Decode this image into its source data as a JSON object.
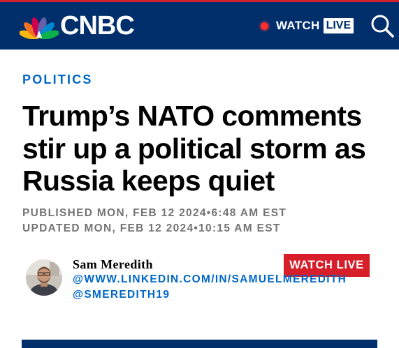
{
  "header": {
    "logo_text": "CNBC",
    "watch_label": "WATCH",
    "live_label": "LIVE",
    "colors": {
      "background": "#002f6c",
      "live_dot": "#ff2d2d",
      "accent_red": "#d61f2a"
    },
    "icons": {
      "logo": "nbc-peacock-icon",
      "search": "search-icon",
      "live": "live-dot-icon"
    }
  },
  "article": {
    "section": "POLITICS",
    "headline": "Trump’s NATO comments stir up a political storm as Russia keeps quiet",
    "published": "PUBLISHED MON, FEB 12 2024•6:48 AM EST",
    "updated": "UPDATED MON, FEB 12 2024•10:15 AM EST"
  },
  "author": {
    "name": "Sam Meredith",
    "linkedin": "@WWW.LINKEDIN.COM/IN/SAMUELMEREDITH",
    "twitter": "@SMEREDITH19"
  },
  "watch_live_button": "WATCH LIVE",
  "colors": {
    "section_link": "#0067c8",
    "meta_gray": "#747474"
  }
}
